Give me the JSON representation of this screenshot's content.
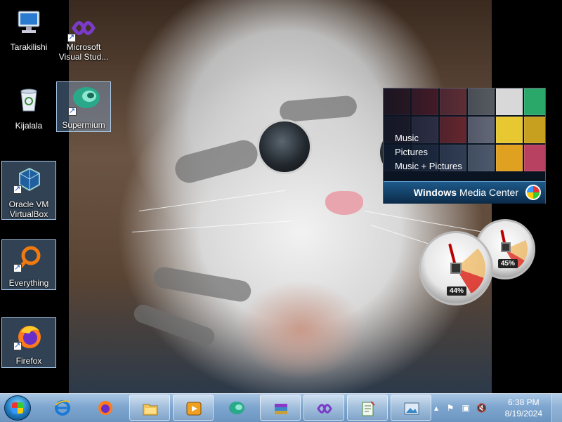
{
  "desktop": {
    "icons": [
      {
        "label": "Tarakilishi",
        "icon": "computer-icon"
      },
      {
        "label": "Microsoft Visual Stud...",
        "icon": "visual-studio-icon"
      },
      {
        "label": "Kijalala",
        "icon": "recycle-bin-icon"
      },
      {
        "label": "Supermium",
        "icon": "supermium-icon"
      },
      {
        "label": "Oracle VM VirtualBox",
        "icon": "virtualbox-icon"
      },
      {
        "label": "Everything",
        "icon": "everything-search-icon"
      },
      {
        "label": "Firefox",
        "icon": "firefox-icon"
      }
    ]
  },
  "media_center_gadget": {
    "items": [
      "Music",
      "Pictures",
      "Music + Pictures"
    ],
    "title_bold": "Windows",
    "title_rest": "Media Center",
    "logo_icon": "windows-orb-icon"
  },
  "cpu_meter_gadget": {
    "cpu": {
      "percent": 44,
      "label": "44%"
    },
    "memory": {
      "percent": 45,
      "label": "45%"
    }
  },
  "taskbar": {
    "start_icon": "windows-start-orb-icon",
    "buttons": [
      {
        "icon": "internet-explorer-icon"
      },
      {
        "icon": "firefox-icon"
      },
      {
        "icon": "file-explorer-icon"
      },
      {
        "icon": "windows-media-player-icon"
      },
      {
        "icon": "supermium-icon"
      },
      {
        "icon": "winrar-icon"
      },
      {
        "icon": "visual-studio-icon"
      },
      {
        "icon": "notepad-plus-plus-icon"
      },
      {
        "icon": "windows-photo-viewer-icon"
      }
    ],
    "tray": {
      "icons": [
        "show-hidden-icons-chevron",
        "action-center-flag-icon",
        "network-icon",
        "volume-muted-icon"
      ],
      "time": "6:38 PM",
      "date": "8/19/2024"
    }
  },
  "colors": {
    "taskbar": "#7ea6cf",
    "selection": "#8cbef0",
    "gauge_needle": "#bb0000"
  }
}
